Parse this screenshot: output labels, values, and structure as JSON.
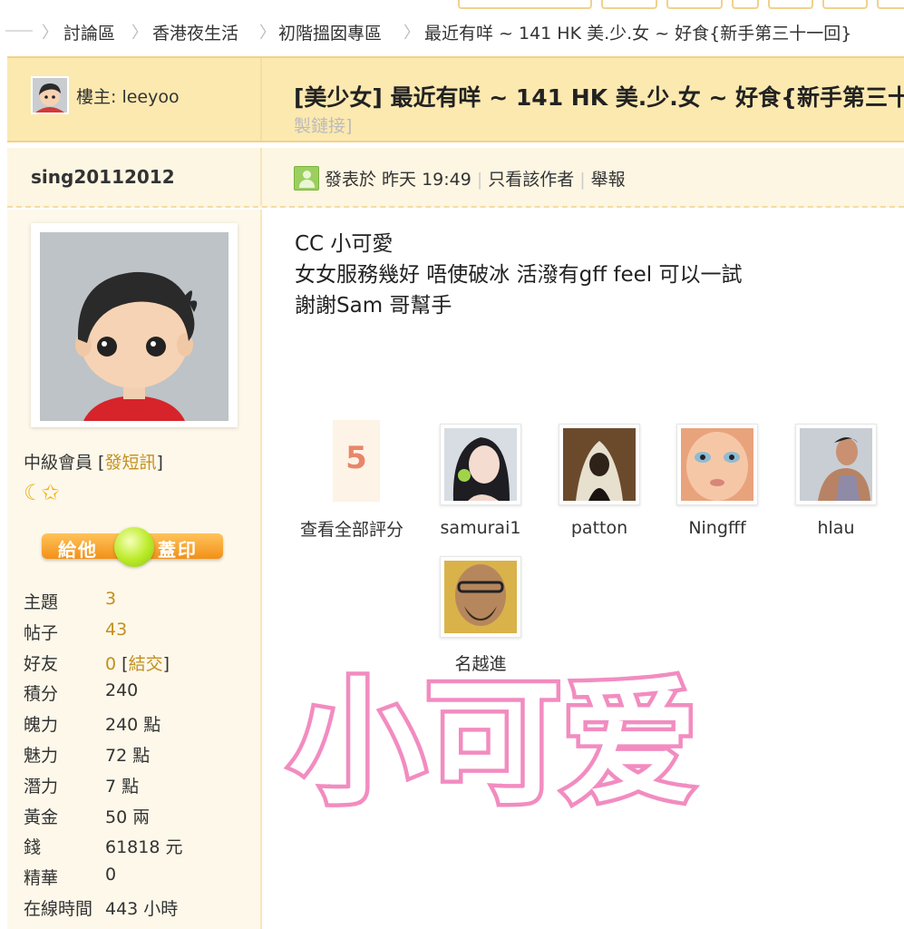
{
  "breadcrumb": [
    "討論區",
    "香港夜生活",
    "初階搵囡專區",
    "最近有咩 ~ 141 HK 美.少.女 ~ 好食{新手第三十一回}"
  ],
  "thread": {
    "owner_label": "樓主: leeyoo",
    "title": "[美少女] 最近有咩 ~ 141 HK 美.少.女 ~ 好食{新手第三十",
    "subtitle": "製鏈接]"
  },
  "post": {
    "author": "sing20112012",
    "posted_label": "發表於 昨天 19:49",
    "only_author": "只看該作者",
    "report": "舉報",
    "lines": [
      "CC 小可愛",
      "女女服務幾好 唔使破冰 活潑有gff feel 可以一試",
      "謝謝Sam 哥幫手"
    ],
    "stamp_text": "小可爱"
  },
  "author_panel": {
    "level_prefix": "中級會員 [",
    "send_pm": "發短訊",
    "level_suffix": "]",
    "rank_icons": "☾✩",
    "stamp_left": "給他",
    "stamp_right": "蓋印",
    "stats": [
      {
        "label": "主題",
        "value": "3"
      },
      {
        "label": "帖子",
        "value": "43"
      },
      {
        "label": "好友",
        "value": "0"
      },
      {
        "label": "積分",
        "value": "240"
      },
      {
        "label": "魄力",
        "value": "240 點"
      },
      {
        "label": "魅力",
        "value": "72 點"
      },
      {
        "label": "潛力",
        "value": "7 點"
      },
      {
        "label": "黃金",
        "value": "50 兩"
      },
      {
        "label": "錢",
        "value": "61818 元"
      },
      {
        "label": "精華",
        "value": "0"
      },
      {
        "label": "在線時間",
        "value": "443 小時"
      }
    ],
    "make_friend": "結交"
  },
  "ratings": {
    "count": "5",
    "view_all": "查看全部評分",
    "raters": [
      "samurai1",
      "patton",
      "Ningfff",
      "hlau",
      "名越進"
    ]
  },
  "colors": {
    "accent_gold": "#c2901e",
    "bar_bg": "#fce9b0",
    "stamp_pink": "#f28cc0"
  }
}
